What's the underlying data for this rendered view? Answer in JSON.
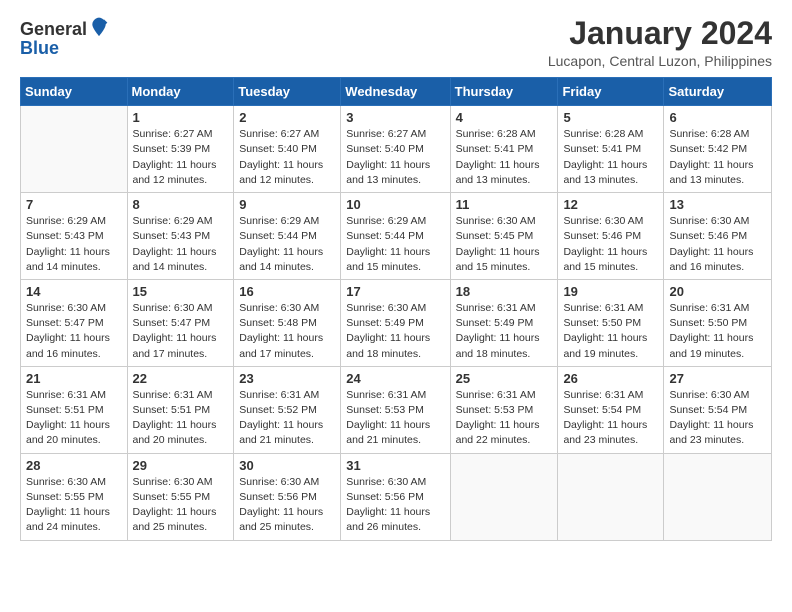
{
  "logo": {
    "general": "General",
    "blue": "Blue"
  },
  "title": "January 2024",
  "location": "Lucapon, Central Luzon, Philippines",
  "headers": [
    "Sunday",
    "Monday",
    "Tuesday",
    "Wednesday",
    "Thursday",
    "Friday",
    "Saturday"
  ],
  "weeks": [
    [
      {
        "day": "",
        "info": ""
      },
      {
        "day": "1",
        "info": "Sunrise: 6:27 AM\nSunset: 5:39 PM\nDaylight: 11 hours\nand 12 minutes."
      },
      {
        "day": "2",
        "info": "Sunrise: 6:27 AM\nSunset: 5:40 PM\nDaylight: 11 hours\nand 12 minutes."
      },
      {
        "day": "3",
        "info": "Sunrise: 6:27 AM\nSunset: 5:40 PM\nDaylight: 11 hours\nand 13 minutes."
      },
      {
        "day": "4",
        "info": "Sunrise: 6:28 AM\nSunset: 5:41 PM\nDaylight: 11 hours\nand 13 minutes."
      },
      {
        "day": "5",
        "info": "Sunrise: 6:28 AM\nSunset: 5:41 PM\nDaylight: 11 hours\nand 13 minutes."
      },
      {
        "day": "6",
        "info": "Sunrise: 6:28 AM\nSunset: 5:42 PM\nDaylight: 11 hours\nand 13 minutes."
      }
    ],
    [
      {
        "day": "7",
        "info": "Sunrise: 6:29 AM\nSunset: 5:43 PM\nDaylight: 11 hours\nand 14 minutes."
      },
      {
        "day": "8",
        "info": "Sunrise: 6:29 AM\nSunset: 5:43 PM\nDaylight: 11 hours\nand 14 minutes."
      },
      {
        "day": "9",
        "info": "Sunrise: 6:29 AM\nSunset: 5:44 PM\nDaylight: 11 hours\nand 14 minutes."
      },
      {
        "day": "10",
        "info": "Sunrise: 6:29 AM\nSunset: 5:44 PM\nDaylight: 11 hours\nand 15 minutes."
      },
      {
        "day": "11",
        "info": "Sunrise: 6:30 AM\nSunset: 5:45 PM\nDaylight: 11 hours\nand 15 minutes."
      },
      {
        "day": "12",
        "info": "Sunrise: 6:30 AM\nSunset: 5:46 PM\nDaylight: 11 hours\nand 15 minutes."
      },
      {
        "day": "13",
        "info": "Sunrise: 6:30 AM\nSunset: 5:46 PM\nDaylight: 11 hours\nand 16 minutes."
      }
    ],
    [
      {
        "day": "14",
        "info": "Sunrise: 6:30 AM\nSunset: 5:47 PM\nDaylight: 11 hours\nand 16 minutes."
      },
      {
        "day": "15",
        "info": "Sunrise: 6:30 AM\nSunset: 5:47 PM\nDaylight: 11 hours\nand 17 minutes."
      },
      {
        "day": "16",
        "info": "Sunrise: 6:30 AM\nSunset: 5:48 PM\nDaylight: 11 hours\nand 17 minutes."
      },
      {
        "day": "17",
        "info": "Sunrise: 6:30 AM\nSunset: 5:49 PM\nDaylight: 11 hours\nand 18 minutes."
      },
      {
        "day": "18",
        "info": "Sunrise: 6:31 AM\nSunset: 5:49 PM\nDaylight: 11 hours\nand 18 minutes."
      },
      {
        "day": "19",
        "info": "Sunrise: 6:31 AM\nSunset: 5:50 PM\nDaylight: 11 hours\nand 19 minutes."
      },
      {
        "day": "20",
        "info": "Sunrise: 6:31 AM\nSunset: 5:50 PM\nDaylight: 11 hours\nand 19 minutes."
      }
    ],
    [
      {
        "day": "21",
        "info": "Sunrise: 6:31 AM\nSunset: 5:51 PM\nDaylight: 11 hours\nand 20 minutes."
      },
      {
        "day": "22",
        "info": "Sunrise: 6:31 AM\nSunset: 5:51 PM\nDaylight: 11 hours\nand 20 minutes."
      },
      {
        "day": "23",
        "info": "Sunrise: 6:31 AM\nSunset: 5:52 PM\nDaylight: 11 hours\nand 21 minutes."
      },
      {
        "day": "24",
        "info": "Sunrise: 6:31 AM\nSunset: 5:53 PM\nDaylight: 11 hours\nand 21 minutes."
      },
      {
        "day": "25",
        "info": "Sunrise: 6:31 AM\nSunset: 5:53 PM\nDaylight: 11 hours\nand 22 minutes."
      },
      {
        "day": "26",
        "info": "Sunrise: 6:31 AM\nSunset: 5:54 PM\nDaylight: 11 hours\nand 23 minutes."
      },
      {
        "day": "27",
        "info": "Sunrise: 6:30 AM\nSunset: 5:54 PM\nDaylight: 11 hours\nand 23 minutes."
      }
    ],
    [
      {
        "day": "28",
        "info": "Sunrise: 6:30 AM\nSunset: 5:55 PM\nDaylight: 11 hours\nand 24 minutes."
      },
      {
        "day": "29",
        "info": "Sunrise: 6:30 AM\nSunset: 5:55 PM\nDaylight: 11 hours\nand 25 minutes."
      },
      {
        "day": "30",
        "info": "Sunrise: 6:30 AM\nSunset: 5:56 PM\nDaylight: 11 hours\nand 25 minutes."
      },
      {
        "day": "31",
        "info": "Sunrise: 6:30 AM\nSunset: 5:56 PM\nDaylight: 11 hours\nand 26 minutes."
      },
      {
        "day": "",
        "info": ""
      },
      {
        "day": "",
        "info": ""
      },
      {
        "day": "",
        "info": ""
      }
    ]
  ]
}
